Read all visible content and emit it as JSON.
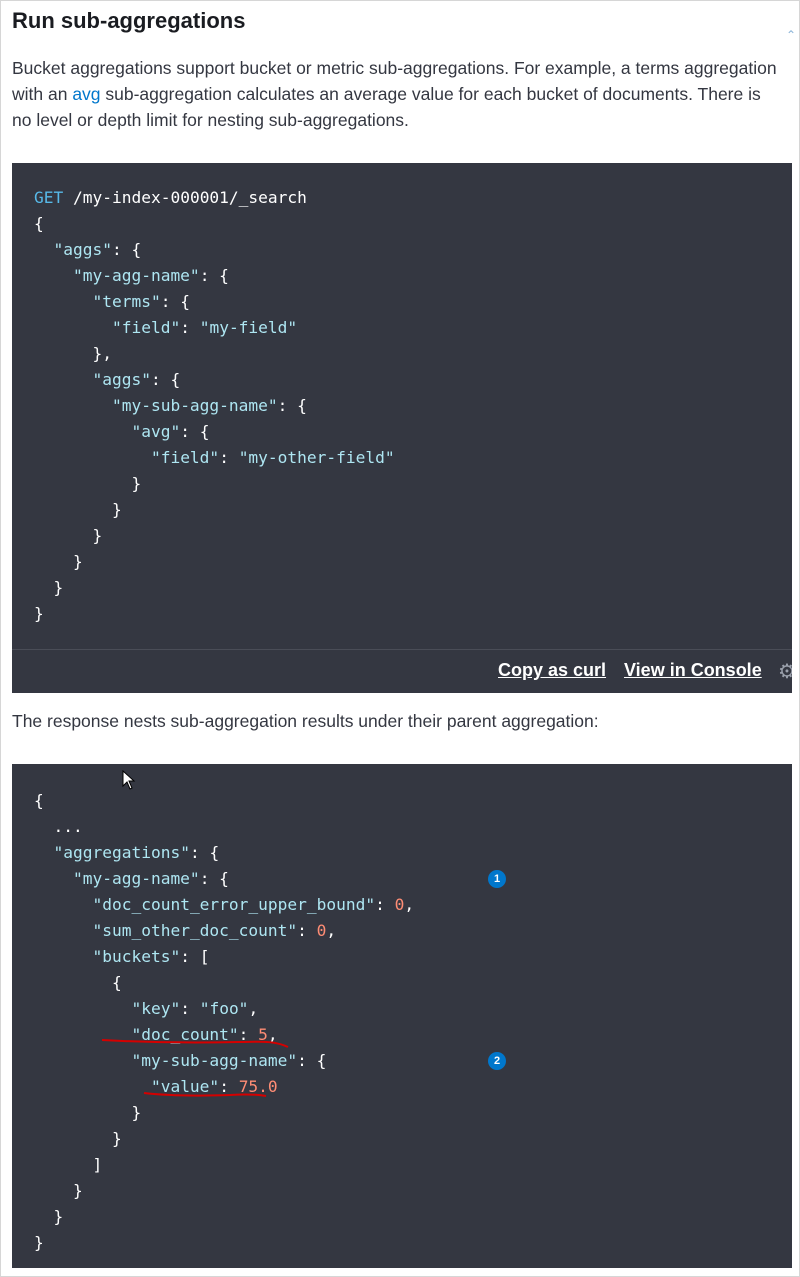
{
  "section": {
    "title": "Run sub-aggregations",
    "para_before_link": "Bucket aggregations support bucket or metric sub-aggregations. For example, a terms aggregation with an ",
    "para_link": "avg",
    "para_after_link": " sub-aggregation calculates an average value for each bucket of documents. There is no level or depth limit for nesting sub-aggregations."
  },
  "request": {
    "method": "GET",
    "path": " /my-index-000001/_search",
    "lines": [
      "{",
      "  \"aggs\": {",
      "    \"my-agg-name\": {",
      "      \"terms\": {",
      "        \"field\": \"my-field\"",
      "      },",
      "      \"aggs\": {",
      "        \"my-sub-agg-name\": {",
      "          \"avg\": {",
      "            \"field\": \"my-other-field\"",
      "          }",
      "        }",
      "      }",
      "    }",
      "  }",
      "}"
    ]
  },
  "toolbar": {
    "copy_label": "Copy as curl",
    "console_label": "View in Console",
    "settings_icon": "gear-icon"
  },
  "response_intro": "The response nests sub-aggregation results under their parent aggregation:",
  "response": {
    "lines": [
      "{",
      "  ...",
      "  \"aggregations\": {",
      "    \"my-agg-name\": {",
      "      \"doc_count_error_upper_bound\": 0,",
      "      \"sum_other_doc_count\": 0,",
      "      \"buckets\": [",
      "        {",
      "          \"key\": \"foo\",",
      "          \"doc_count\": 5,",
      "          \"my-sub-agg-name\": {",
      "            \"value\": 75.0",
      "          }",
      "        }",
      "      ]",
      "    }",
      "  }",
      "}"
    ],
    "callout_1": "1",
    "callout_2": "2"
  },
  "colors": {
    "code_bg": "#343741",
    "link": "#0077cc",
    "string": "#aee6f2",
    "number": "#ff8d75",
    "keyword": "#57b9e8",
    "annotation": "#d40000"
  }
}
